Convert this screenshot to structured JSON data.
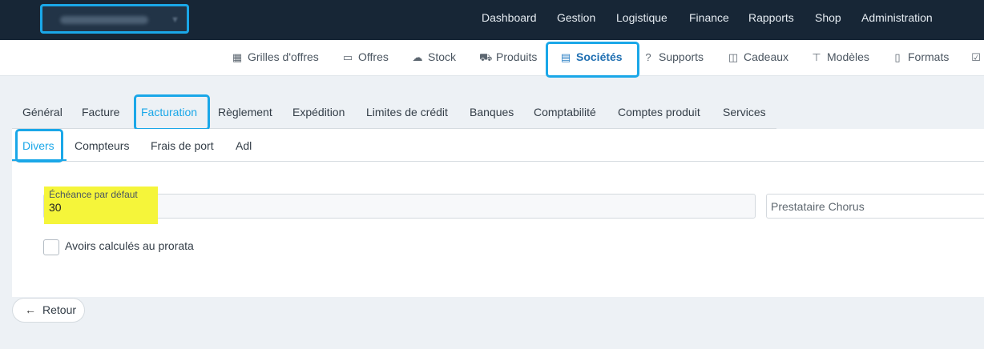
{
  "topnav": {
    "items": [
      "Dashboard",
      "Gestion",
      "Logistique",
      "Finance",
      "Rapports",
      "Shop",
      "Administration"
    ]
  },
  "subnav": {
    "items": [
      {
        "label": "Grilles d'offres",
        "icon": "grid-icon"
      },
      {
        "label": "Offres",
        "icon": "book-icon"
      },
      {
        "label": "Stock",
        "icon": "cloud-upload-icon"
      },
      {
        "label": "Produits",
        "icon": "cart-icon"
      },
      {
        "label": "Sociétés",
        "icon": "building-icon"
      },
      {
        "label": "Supports",
        "icon": "help-circle-icon"
      },
      {
        "label": "Cadeaux",
        "icon": "gift-icon"
      },
      {
        "label": "Modèles",
        "icon": "paint-roller-icon"
      },
      {
        "label": "Formats",
        "icon": "file-icon"
      }
    ]
  },
  "tabs": [
    "Général",
    "Facture",
    "Facturation",
    "Règlement",
    "Expédition",
    "Limites de crédit",
    "Banques",
    "Comptabilité",
    "Comptes produit",
    "Services"
  ],
  "subtabs": [
    "Divers",
    "Compteurs",
    "Frais de port",
    "Adl"
  ],
  "form": {
    "echeance_label": "Échéance par défaut",
    "echeance_value": "30",
    "prestataire_placeholder": "Prestataire Chorus",
    "avoirs_label": "Avoirs calculés au prorata"
  },
  "back_label": "Retour",
  "colors": {
    "topbar": "#172636",
    "accent": "#1aa7e8",
    "highlight": "#f5f53a"
  }
}
